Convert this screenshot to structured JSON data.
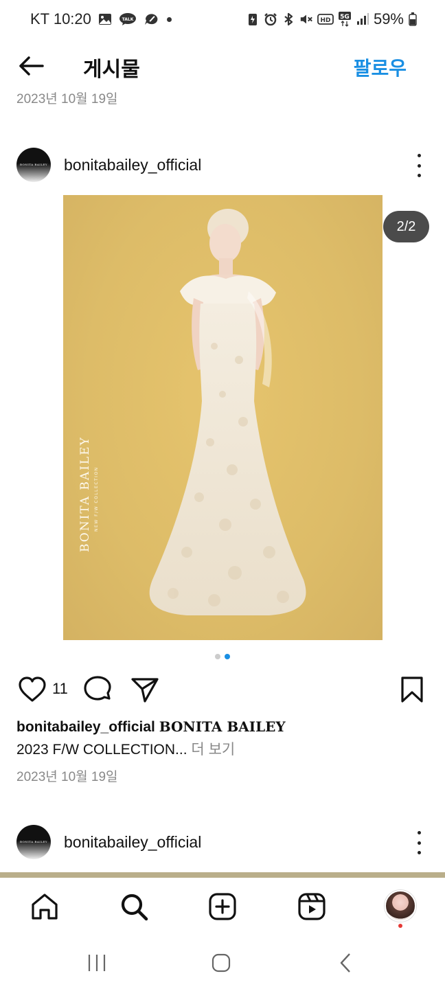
{
  "status_bar": {
    "carrier_time": "KT 10:20",
    "battery": "59%",
    "icons": [
      "gallery-icon",
      "kakaotalk-icon",
      "threads-icon",
      "dot-icon",
      "data-saver-icon",
      "alarm-icon",
      "bluetooth-icon",
      "mute-icon",
      "hd-icon",
      "5g-icon",
      "signal-icon",
      "battery-icon"
    ],
    "talk_label": "TALK",
    "hd_label": "HD",
    "fiveg_label": "5G"
  },
  "header": {
    "title": "게시물",
    "follow_label": "팔로우",
    "back_icon": "arrow-left-icon"
  },
  "previous_post_date": "2023년 10월 19일",
  "post": {
    "username": "bonitabailey_official",
    "avatar_text": "BONITA BAILEY",
    "image": {
      "brand": "BONITA BAILEY",
      "brand_sub": "NEW F/W COLLECTION",
      "counter": "2/2",
      "description": "wedding dress photo"
    },
    "carousel": {
      "count": 2,
      "active_index": 1
    },
    "likes": "11",
    "caption": {
      "user": "bonitabailey_official",
      "title": "BONITA BAILEY",
      "line2": "2023 F/W COLLECTION...",
      "more": "더 보기"
    },
    "date": "2023년 10월 19일"
  },
  "next_post": {
    "username": "bonitabailey_official",
    "avatar_text": "BONITA BAILEY"
  },
  "bottom_nav": {
    "items": [
      "home-icon",
      "search-icon",
      "create-icon",
      "reels-icon",
      "profile-avatar"
    ]
  },
  "system_nav": {
    "items": [
      "recents-icon",
      "home-icon",
      "back-icon"
    ]
  },
  "colors": {
    "accent": "#1a8fe3",
    "image_bg": "#ddbc68",
    "notification": "#e53935"
  }
}
